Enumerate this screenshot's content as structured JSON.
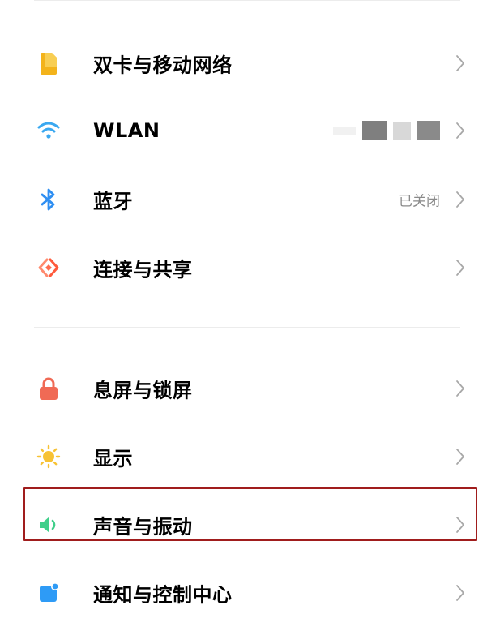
{
  "settings": {
    "group1": [
      {
        "label": "双卡与移动网络",
        "value": ""
      },
      {
        "label": "WLAN",
        "value": ""
      },
      {
        "label": "蓝牙",
        "value": "已关闭"
      },
      {
        "label": "连接与共享",
        "value": ""
      }
    ],
    "group2": [
      {
        "label": "息屏与锁屏",
        "value": ""
      },
      {
        "label": "显示",
        "value": ""
      },
      {
        "label": "声音与振动",
        "value": ""
      },
      {
        "label": "通知与控制中心",
        "value": ""
      }
    ]
  },
  "colors": {
    "sim_icon": "#f3b31b",
    "wlan_icon": "#3aa8f0",
    "bluetooth_icon": "#2f8ff2",
    "connection_icon": "#ff6a4d",
    "lock_icon": "#f06a55",
    "display_icon": "#f7c234",
    "sound_icon": "#3fcf8a",
    "notify_icon": "#2e9bf6",
    "highlight_border": "#a01d1d"
  },
  "icons": {
    "sim": "sim-card-icon",
    "wlan": "wifi-icon",
    "bluetooth": "bluetooth-icon",
    "connection": "connection-share-icon",
    "lock": "lock-icon",
    "display": "brightness-icon",
    "sound": "speaker-icon",
    "notify": "notification-icon",
    "chevron": "chevron-right-icon"
  }
}
